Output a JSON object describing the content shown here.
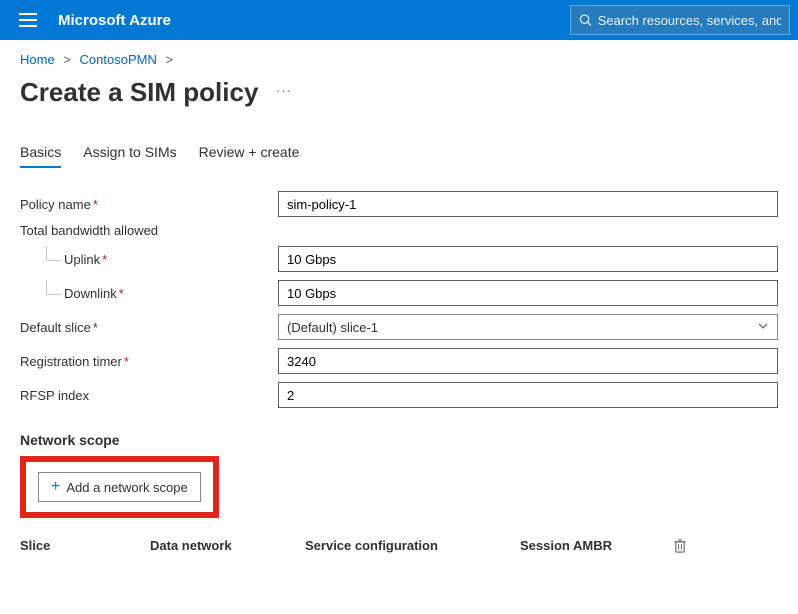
{
  "header": {
    "brand": "Microsoft Azure",
    "search_placeholder": "Search resources, services, and docs"
  },
  "breadcrumb": {
    "home": "Home",
    "resource": "ContosoPMN"
  },
  "page": {
    "title": "Create a SIM policy"
  },
  "tabs": {
    "basics": "Basics",
    "assign": "Assign to SIMs",
    "review": "Review + create"
  },
  "form": {
    "policy_name_label": "Policy name",
    "policy_name_value": "sim-policy-1",
    "bandwidth_group": "Total bandwidth allowed",
    "uplink_label": "Uplink",
    "uplink_value": "10 Gbps",
    "downlink_label": "Downlink",
    "downlink_value": "10 Gbps",
    "default_slice_label": "Default slice",
    "default_slice_value": "(Default) slice-1",
    "reg_timer_label": "Registration timer",
    "reg_timer_value": "3240",
    "rfsp_label": "RFSP index",
    "rfsp_value": "2"
  },
  "network_scope": {
    "heading": "Network scope",
    "add_button": "Add a network scope",
    "columns": {
      "slice": "Slice",
      "data_network": "Data network",
      "service_config": "Service configuration",
      "session_ambr": "Session AMBR"
    }
  }
}
